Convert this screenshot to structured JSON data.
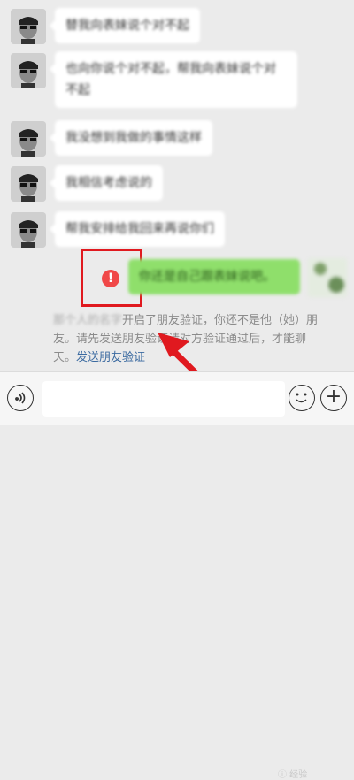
{
  "messages": [
    {
      "text": "替我向表妹说个对不起"
    },
    {
      "text": "也向你说个对不起，帮我向表妹说个对不起"
    },
    {
      "text": "我没想到我做的事情这样"
    },
    {
      "text": "我相信考虑说的"
    },
    {
      "text": "帮我安排给我回来再说你们"
    }
  ],
  "sent_message": {
    "text": "你还是自己跟表妹说吧。"
  },
  "error_mark": "!",
  "system_notice": {
    "name": "那个人的名字",
    "part1": "开启了朋友验证，你还不是他（她）朋友。请先发送朋友验证请",
    "part2": "对方验证通过后，才能聊天。",
    "link": "发送朋友验证"
  },
  "input": {
    "placeholder": ""
  },
  "plus_label": "+",
  "watermark": "ⓘ 经验"
}
